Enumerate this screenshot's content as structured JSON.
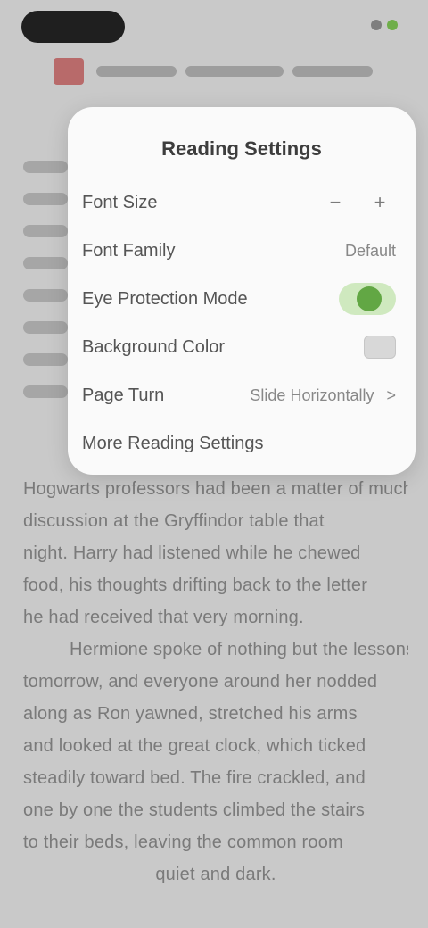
{
  "status_bar": {
    "colors": {
      "pill": "#1f1f1f",
      "battery": "#6fae4a"
    }
  },
  "reader": {
    "ad_icon": "ad-icon",
    "body_lines": [
      "Hogwarts professors had been a matter of much",
      "discussion at the Gryffindor table that",
      "night. Harry had listened while he chewed",
      "food, his thoughts drifting back to the letter",
      "he had received that very morning.",
      "Hermione spoke of nothing but the lessons",
      "tomorrow, and everyone around her nodded",
      "along as Ron yawned, stretched his arms",
      "and looked at the great clock, which ticked",
      "steadily toward bed. The fire crackled, and",
      "one by one the students climbed the stairs",
      "to their beds, leaving the common room",
      "quiet and dark."
    ]
  },
  "settings": {
    "title": "Reading Settings",
    "font_size": {
      "label": "Font Size",
      "minus": "−",
      "plus": "+"
    },
    "font_family": {
      "label": "Font Family",
      "value": "Default"
    },
    "night_mode": {
      "label": "Eye Protection Mode",
      "on": true
    },
    "background": {
      "label": "Background Color",
      "swatch": "#d8d8d8"
    },
    "page_turn": {
      "label": "Page Turn",
      "value": "Slide Horizontally",
      "chevron": ">"
    },
    "more": {
      "label": "More Reading Settings"
    },
    "colors": {
      "accent": "#62a744",
      "accent_light": "#cfe9bf"
    }
  }
}
